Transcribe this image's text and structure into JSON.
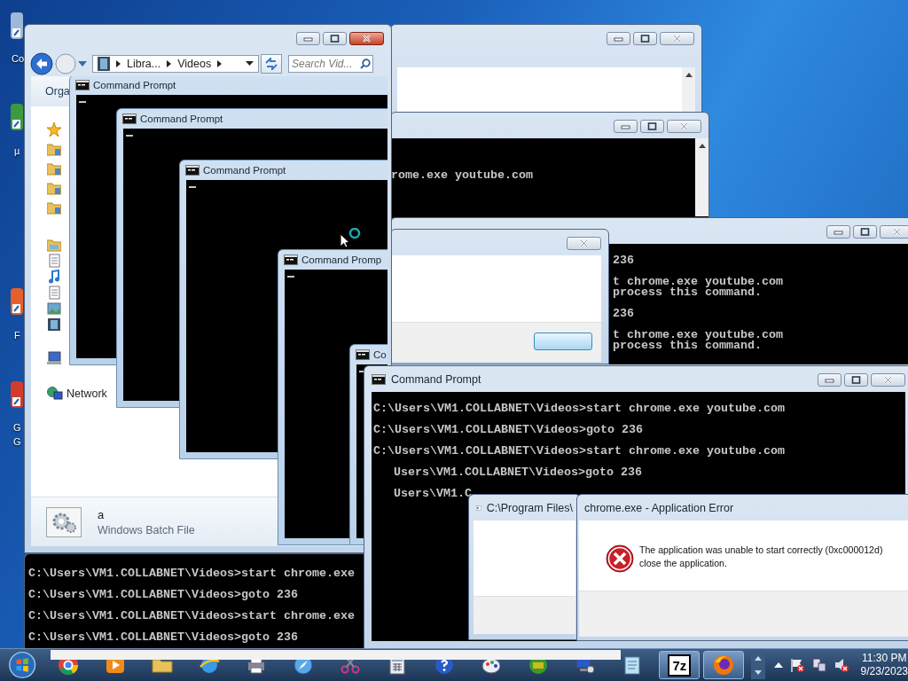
{
  "desktop_icons": [
    {
      "label": "Co"
    },
    {
      "label": "µ"
    },
    {
      "label": "F"
    },
    {
      "label": "G\nG"
    }
  ],
  "windows": [
    {
      "kind": "plain"
    },
    {
      "kind": "console",
      "blocks": [
        [
          "rome.exe youtube.com"
        ]
      ]
    },
    {
      "kind": "console",
      "blocks": [
        [
          "236"
        ],
        [
          "t chrome.exe youtube.com",
          "process this command."
        ],
        [
          "236"
        ],
        [
          "t chrome.exe youtube.com",
          "process this command."
        ]
      ]
    },
    {
      "kind": "dialog"
    },
    {
      "kind": "explorer",
      "address": [
        "Libra...",
        "Videos"
      ],
      "search_placeholder": "Search Vid...",
      "toolbar": "Orga",
      "nav": [
        {
          "label": "Network"
        }
      ],
      "details": {
        "name": "a",
        "type": "Windows Batch File"
      },
      "stacked_windows": [
        {
          "title": "Command Prompt"
        },
        {
          "title": "Command Prompt"
        },
        {
          "title": "Command Prompt"
        },
        {
          "title": "Command Promp"
        },
        {
          "title": "Co"
        }
      ]
    },
    {
      "kind": "console",
      "blocks": [
        [
          "C:\\Users\\VM1.COLLABNET\\Videos>start chrome.exe"
        ],
        [
          "C:\\Users\\VM1.COLLABNET\\Videos>goto 236"
        ],
        [
          "C:\\Users\\VM1.COLLABNET\\Videos>start chrome.exe"
        ],
        [
          "C:\\Users\\VM1.COLLABNET\\Videos>goto 236"
        ]
      ]
    },
    {
      "kind": "console",
      "title": "Command Prompt",
      "blocks": [
        [
          "C:\\Users\\VM1.COLLABNET\\Videos>start chrome.exe youtube.com"
        ],
        [
          "C:\\Users\\VM1.COLLABNET\\Videos>goto 236"
        ],
        [
          "C:\\Users\\VM1.COLLABNET\\Videos>start chrome.exe youtube.com"
        ],
        [
          "Users\\VM1.COLLABNET\\Videos>goto 236"
        ],
        [
          "Users\\VM1.C"
        ]
      ]
    },
    {
      "kind": "small_dialog",
      "title": "C:\\Program Files\\"
    },
    {
      "kind": "error",
      "title": "chrome.exe - Application Error",
      "message": "The application was unable to start correctly (0xc000012d)\nclose the application."
    }
  ],
  "taskbar": {
    "app_label": "7z",
    "clock": {
      "time": "11:30 PM",
      "date": "9/23/2023"
    }
  }
}
